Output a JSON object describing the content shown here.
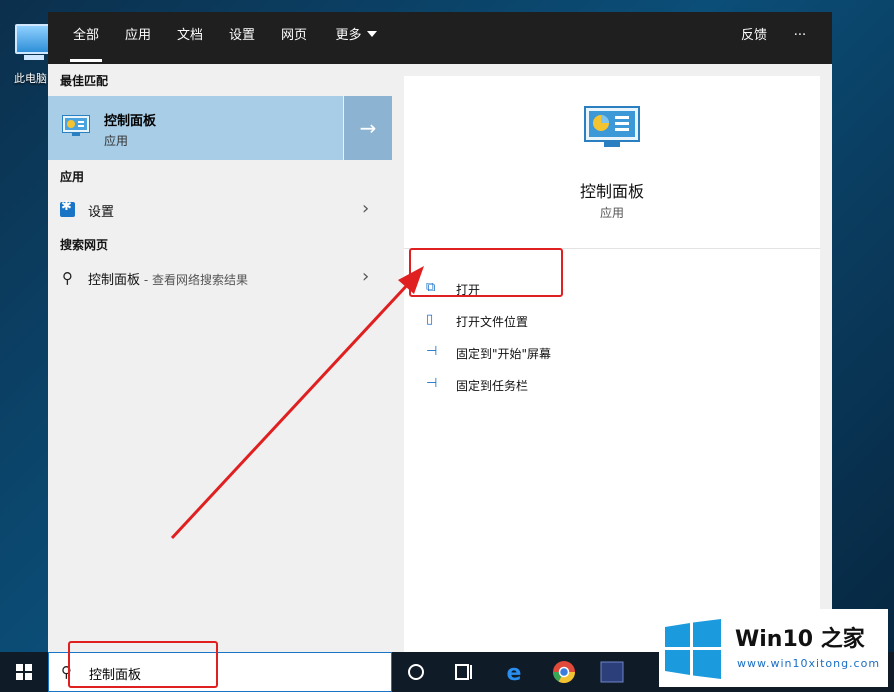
{
  "desktop": {
    "icon_label": "此电脑"
  },
  "tabs": [
    {
      "label": "全部",
      "active": true
    },
    {
      "label": "应用"
    },
    {
      "label": "文档"
    },
    {
      "label": "设置"
    },
    {
      "label": "网页"
    },
    {
      "label": "更多"
    }
  ],
  "top_right": {
    "feedback": "反馈",
    "more": "···"
  },
  "left": {
    "best_match_heading": "最佳匹配",
    "best_match": {
      "title": "控制面板",
      "subtitle": "应用",
      "arrow": "→"
    },
    "apps_heading": "应用",
    "apps": [
      {
        "label": "设置",
        "icon": "gear-icon"
      }
    ],
    "web_heading": "搜索网页",
    "web": [
      {
        "label": "控制面板",
        "sub": " - 查看网络搜索结果"
      }
    ],
    "chevron": "›"
  },
  "right": {
    "title": "控制面板",
    "subtitle": "应用",
    "actions": [
      {
        "label": "打开",
        "icon": "open-icon"
      },
      {
        "label": "打开文件位置",
        "icon": "file-location-icon"
      },
      {
        "label": "固定到\"开始\"屏幕",
        "icon": "pin-icon"
      },
      {
        "label": "固定到任务栏",
        "icon": "pin-icon"
      }
    ]
  },
  "search": {
    "value": "控制面板"
  },
  "watermark": {
    "brand": "Win10 之家",
    "url": "www.win10xitong.com"
  },
  "colors": {
    "accent": "#1a74c6",
    "highlight": "#a8cde7",
    "annotation": "#e02020"
  }
}
